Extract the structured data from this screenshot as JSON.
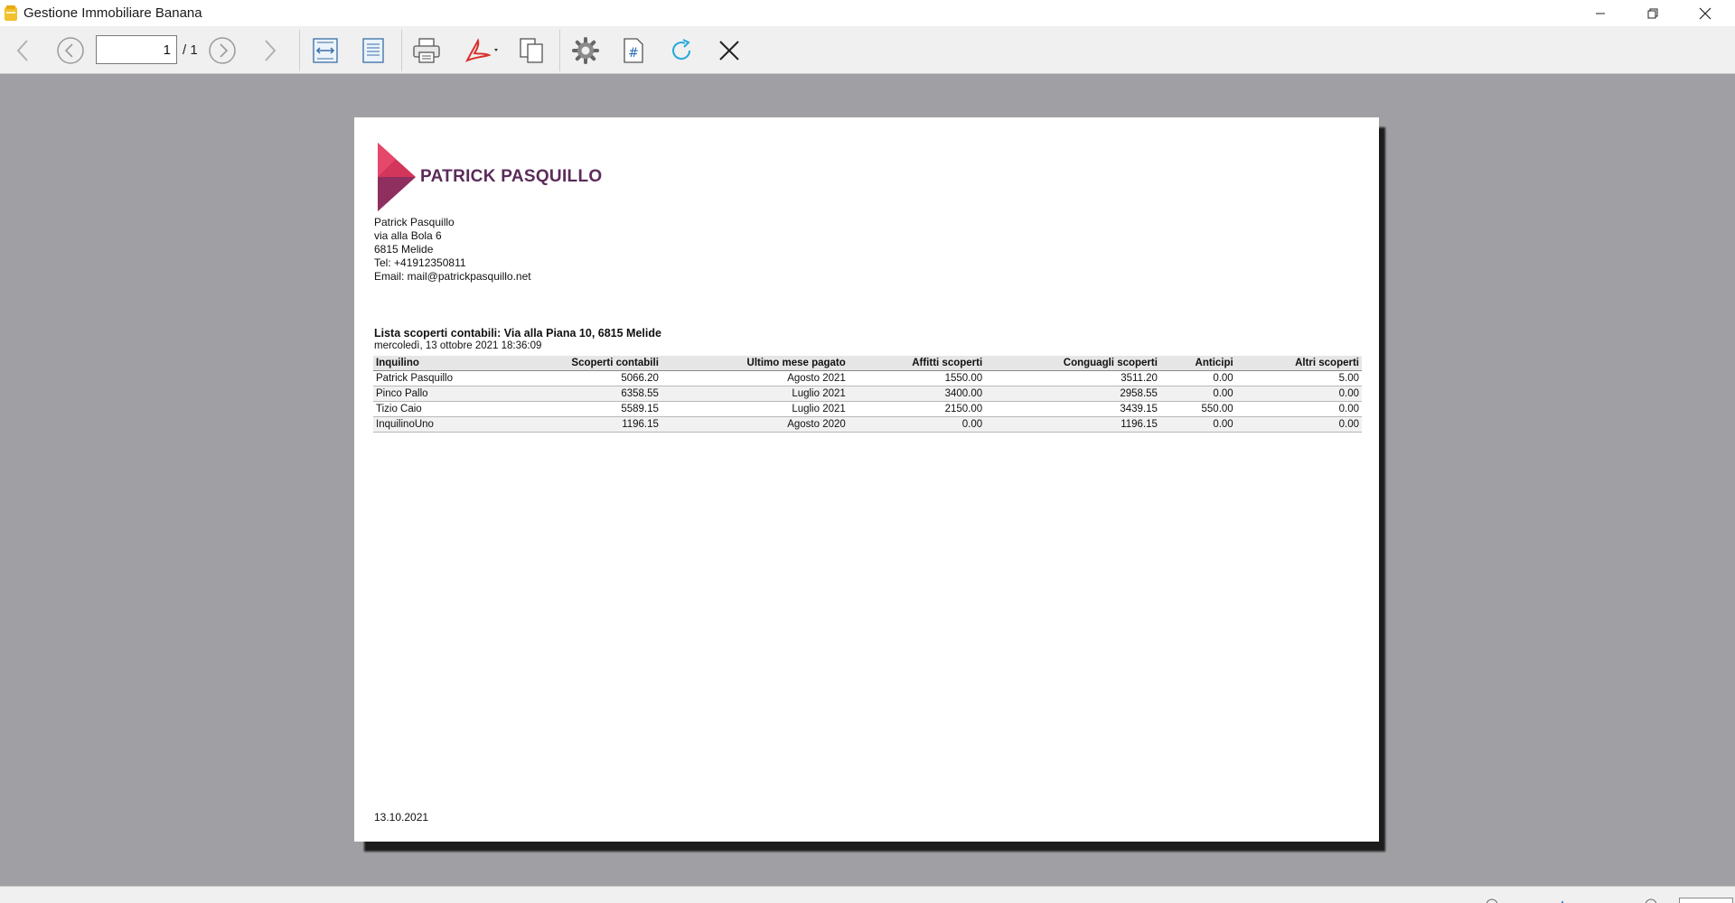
{
  "window": {
    "title": "Gestione Immobiliare Banana",
    "minimize_icon": "minimize-icon",
    "maximize_icon": "restore-icon",
    "close_icon": "close-icon"
  },
  "toolbar": {
    "page_current": "1",
    "page_total": "/ 1",
    "buttons": [
      "back-arrow-icon",
      "previous-page-icon",
      "next-page-icon",
      "forward-arrow-icon",
      "fit-width-icon",
      "fit-page-icon",
      "print-icon",
      "pdf-export-icon",
      "copy-icon",
      "settings-icon",
      "page-number-icon",
      "refresh-icon",
      "close-icon"
    ]
  },
  "report": {
    "brand": "PATRICK PASQUILLO",
    "address_lines": [
      "Patrick Pasquillo",
      "via alla Bola 6",
      "6815 Melide",
      "Tel: +41912350811",
      "Email: mail@patrickpasquillo.net"
    ],
    "title": "Lista scoperti contabili: Via alla Piana 10, 6815 Melide",
    "date": "mercoledì, 13 ottobre 2021 18:36:09",
    "columns": [
      "Inquilino",
      "Scoperti contabili",
      "Ultimo mese pagato",
      "Affitti scoperti",
      "Conguagli scoperti",
      "Anticipi",
      "Altri scoperti"
    ],
    "rows": [
      [
        "Patrick Pasquillo",
        "5066.20",
        "Agosto 2021",
        "1550.00",
        "3511.20",
        "0.00",
        "5.00"
      ],
      [
        "Pinco Pallo",
        "6358.55",
        "Luglio 2021",
        "3400.00",
        "2958.55",
        "0.00",
        "0.00"
      ],
      [
        "Tizio Caio",
        "5589.15",
        "Luglio 2021",
        "2150.00",
        "3439.15",
        "550.00",
        "0.00"
      ],
      [
        "InquilinoUno",
        "1196.15",
        "Agosto 2020",
        "0.00",
        "1196.15",
        "0.00",
        "0.00"
      ]
    ],
    "footer_date": "13.10.2021"
  },
  "colors": {
    "brand_text": "#5b2b5a",
    "logo_primary": "#d2365a",
    "logo_secondary": "#8e2f60",
    "viewer_background": "#a0a0a4"
  }
}
